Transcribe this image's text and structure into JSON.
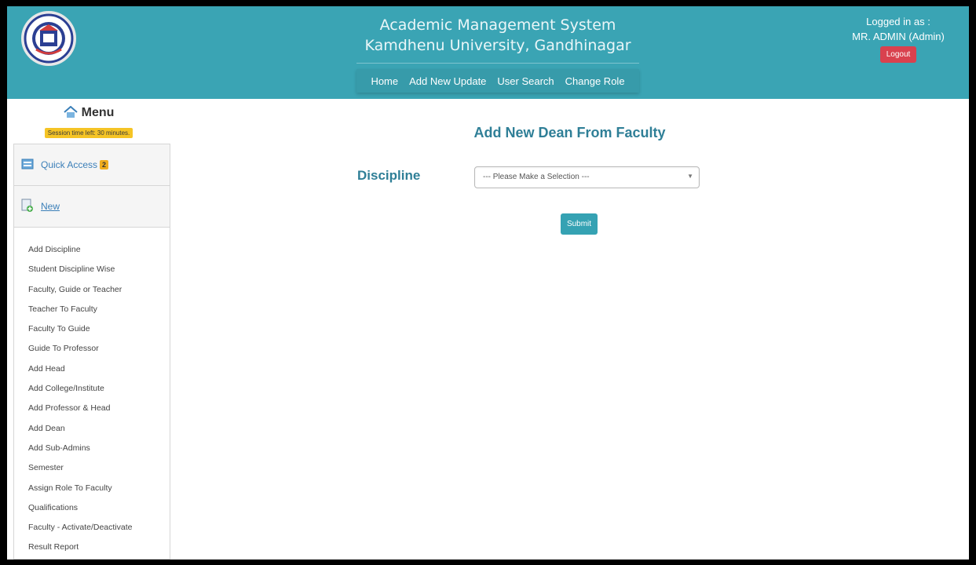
{
  "header": {
    "title_line1": "Academic Management System",
    "title_line2": "Kamdhenu University, Gandhinagar",
    "nav": [
      {
        "label": "Home"
      },
      {
        "label": "Add New Update"
      },
      {
        "label": "User Search"
      },
      {
        "label": "Change Role"
      }
    ],
    "logged_in_label": "Logged in as :",
    "user": "MR. ADMIN (Admin)",
    "logout_label": "Logout"
  },
  "sidebar": {
    "menu_title": "Menu",
    "session_text": "Session time left: 30 minutes.",
    "quick_access_label": "Quick Access",
    "quick_access_count": "2",
    "new_label": "New",
    "items": [
      "Add Discipline",
      "Student Discipline Wise",
      "Faculty, Guide or Teacher",
      "Teacher To Faculty",
      "Faculty To Guide",
      "Guide To Professor",
      "Add Head",
      "Add College/Institute",
      "Add Professor & Head",
      "Add Dean",
      "Add Sub-Admins",
      "Semester",
      "Assign Role To Faculty",
      "Qualifications",
      "Faculty - Activate/Deactivate",
      "Result Report"
    ]
  },
  "main": {
    "page_title": "Add New Dean From Faculty",
    "discipline_label": "Discipline",
    "discipline_select": "--- Please Make a Selection ---",
    "submit_label": "Submit"
  },
  "icons": {
    "home": "home-icon",
    "quick_access": "quick-access-icon",
    "new": "new-document-icon",
    "dropdown": "dropdown-arrow-icon"
  },
  "colors": {
    "header_bg": "#3aa4b4",
    "title_text": "#2f7f97",
    "logout_bg": "#d9414e",
    "session_badge": "#f5c425",
    "submit_bg": "#35a2b3"
  }
}
